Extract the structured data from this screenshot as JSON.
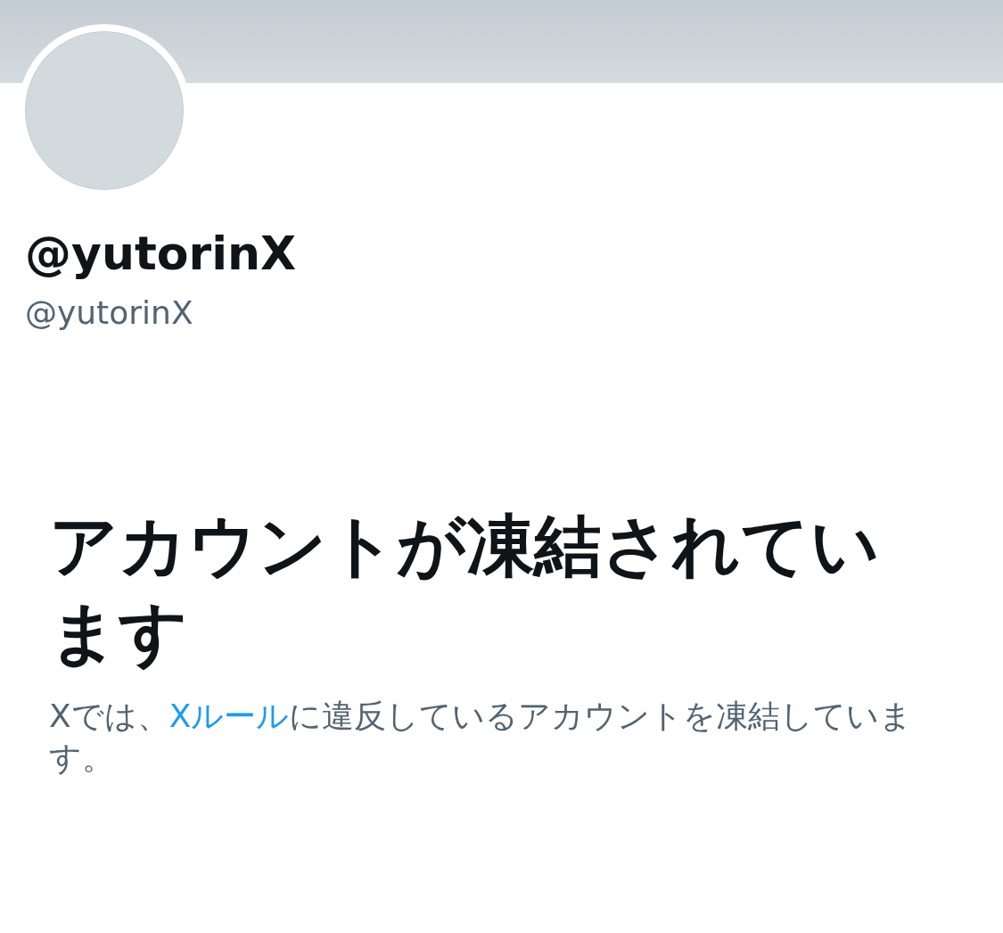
{
  "profile": {
    "display_name": "@yutorinX",
    "handle": "@yutorinX"
  },
  "notice": {
    "title": "アカウントが凍結されています",
    "description": {
      "before": "Xでは、",
      "link": "Xルール",
      "after": "に違反しているアカウントを凍結しています。"
    }
  }
}
